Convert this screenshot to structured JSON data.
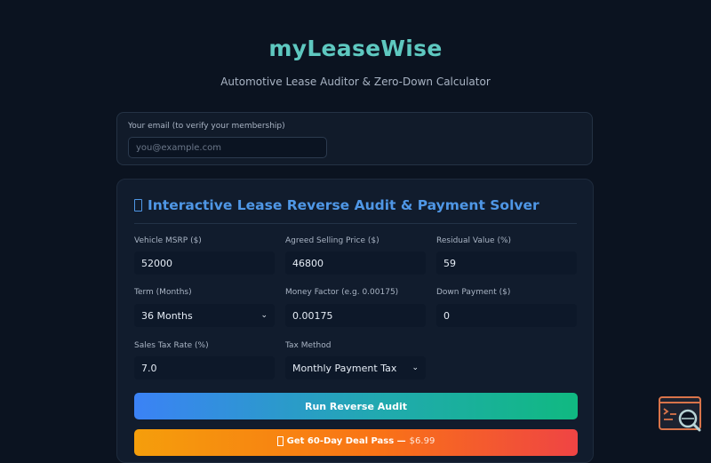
{
  "header": {
    "brand": "myLeaseWise",
    "tagline": "Automotive Lease Auditor & Zero-Down Calculator"
  },
  "membership": {
    "email_label": "Your email (to verify your membership)",
    "email_placeholder": "you@example.com",
    "email_value": ""
  },
  "calculator": {
    "title": "Interactive Lease Reverse Audit & Payment Solver",
    "fields": {
      "msrp": {
        "label": "Vehicle MSRP ($)",
        "value": "52000"
      },
      "selling_price": {
        "label": "Agreed Selling Price ($)",
        "value": "46800"
      },
      "residual": {
        "label": "Residual Value (%)",
        "value": "59"
      },
      "term": {
        "label": "Term (Months)",
        "value": "36 Months"
      },
      "money_factor": {
        "label": "Money Factor (e.g. 0.00175)",
        "value": "0.00175"
      },
      "down_payment": {
        "label": "Down Payment ($)",
        "value": "0"
      },
      "tax_rate": {
        "label": "Sales Tax Rate (%)",
        "value": "7.0"
      },
      "tax_method": {
        "label": "Tax Method",
        "value": "Monthly Payment Tax"
      }
    },
    "run_button": "Run Reverse Audit",
    "pass_button": {
      "label": "Get 60-Day Deal Pass —",
      "price": "$6.99"
    }
  },
  "icons": {
    "title_icon": "document-icon",
    "pass_icon": "ticket-icon",
    "widget_icon": "terminal-search-icon"
  },
  "colors": {
    "brand": "#5ec8c0",
    "title": "#4f97e6",
    "background": "#0b1320",
    "run_gradient": [
      "#3b82f6",
      "#10b981"
    ],
    "pass_gradient": [
      "#f59e0b",
      "#ef4444"
    ]
  }
}
